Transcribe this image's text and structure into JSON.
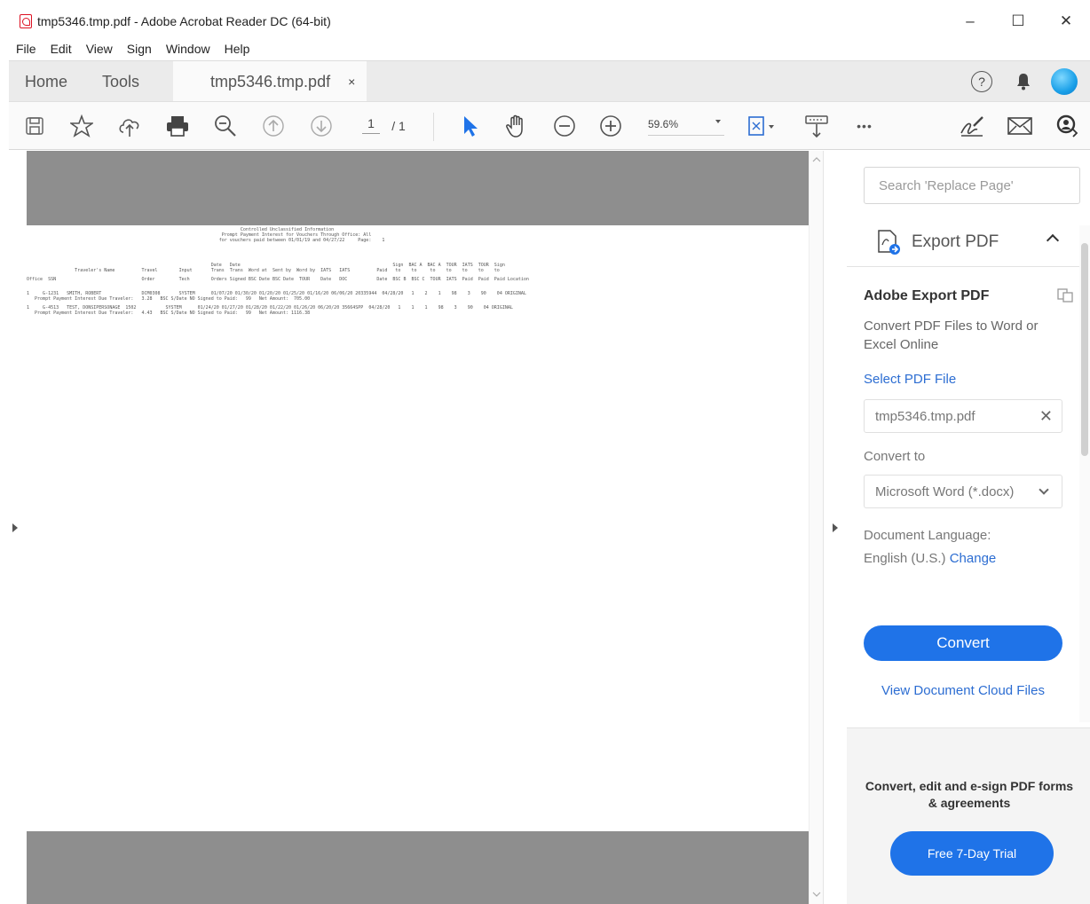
{
  "window": {
    "title": "tmp5346.tmp.pdf - Adobe Acrobat Reader DC (64-bit)",
    "minimize": "–",
    "maximize": "☐",
    "close": "✕"
  },
  "menu": [
    "File",
    "Edit",
    "View",
    "Sign",
    "Window",
    "Help"
  ],
  "tabs": {
    "home": "Home",
    "tools": "Tools",
    "document": "tmp5346.tmp.pdf",
    "close": "×"
  },
  "header_icons": {
    "help": "?"
  },
  "toolbar": {
    "page_current": "1",
    "page_total": "/ 1",
    "zoom": "59.6%",
    "more": "•••"
  },
  "pdf": {
    "lines": [
      "                                                                                Controlled Unclassified Information",
      "                                                                         Prompt Payment Interest for Vouchers Through Office: All",
      "                                                                        for vouchers paid between 01/01/19 and 04/27/22     Page:    1",
      "",
      "                                                                     Date   Date                                                         Sign  BAC A  BAC A  TOUR  IATS  TOUR  Sign",
      "                  Traveler's Name          Travel        Input       Trans  Trans  Word at  Sent by  Word by  IATS   IATS          Paid   to    to     to    to    to    to    to",
      "Office  SSN                                Order         Tech        Orders Signed BSC Date BSC Date  TOUR    Date   DOC           Date  BSC B  BSC C  TOUR  IATS  Paid  Paid  Paid Location",
      "",
      "1     G-1231   SMITH, ROBERT               DCM0308       SYSTEM      01/07/20 01/30/20 01/20/20 01/25/20 01/16/20 06/06/20 20335944  04/28/20   1    2    1    98    3    90    04 ORIGINAL",
      "   Prompt Payment Interest Due Traveler:   3.28   BSC S/Date NO Signed to Paid:   99   Net Amount:  705.00",
      "1     G-4513   TEST, DONSIPERSONAGE  1502           SYSTEM      01/24/20 01/27/20 01/28/20 01/22/20 01/26/20 06/20/20 35664SPP  04/28/20   1    1    1    98    3    90    04 ORIGINAL",
      "   Prompt Payment Interest Due Traveler:   4.43   BSC S/Date NO Signed to Paid:   99   Net Amount: 1116.38"
    ]
  },
  "panel": {
    "search_placeholder": "Search 'Replace Page'",
    "export_label": "Export PDF",
    "aep_title": "Adobe Export PDF",
    "aep_desc": "Convert PDF Files to Word or Excel Online",
    "select_link": "Select PDF File",
    "file_name": "tmp5346.tmp.pdf",
    "file_clear": "✕",
    "convert_to_label": "Convert to",
    "convert_to_value": "Microsoft Word (*.docx)",
    "doc_lang_label": "Document Language:",
    "doc_lang_value": "English (U.S.)",
    "change_link": "Change",
    "convert_button": "Convert",
    "view_cloud": "View Document Cloud Files",
    "promo_text": "Convert, edit and e-sign PDF forms & agreements",
    "trial_button": "Free 7-Day Trial"
  },
  "colors": {
    "accent": "#1f73e8",
    "link": "#2c6dd2",
    "gray_page_bg": "#8e8e8e"
  }
}
